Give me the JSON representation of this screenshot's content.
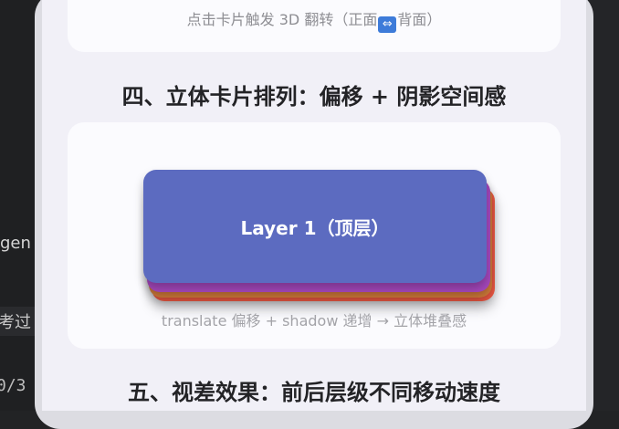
{
  "editor": {
    "line_fragment_1": "gen",
    "line_fragment_2": "考过",
    "line_number": "0/3"
  },
  "screen": {
    "flip_caption_prefix": "点击卡片触发 3D 翻转（正面",
    "flip_icon": "⇔",
    "flip_caption_suffix": "背面）",
    "section4_title": "四、立体卡片排列：偏移 + 阴影空间感",
    "layer1_label": "Layer 1（顶层）",
    "stack_caption": "translate 偏移 + shadow 递增 → 立体堆叠感",
    "section5_title": "五、视差效果：前后层级不同移动速度"
  },
  "colors": {
    "layer1": "#5c6bc0",
    "layer2": "#a447bb",
    "layer3": "#cf7a3a",
    "layer4": "#f05a45"
  }
}
